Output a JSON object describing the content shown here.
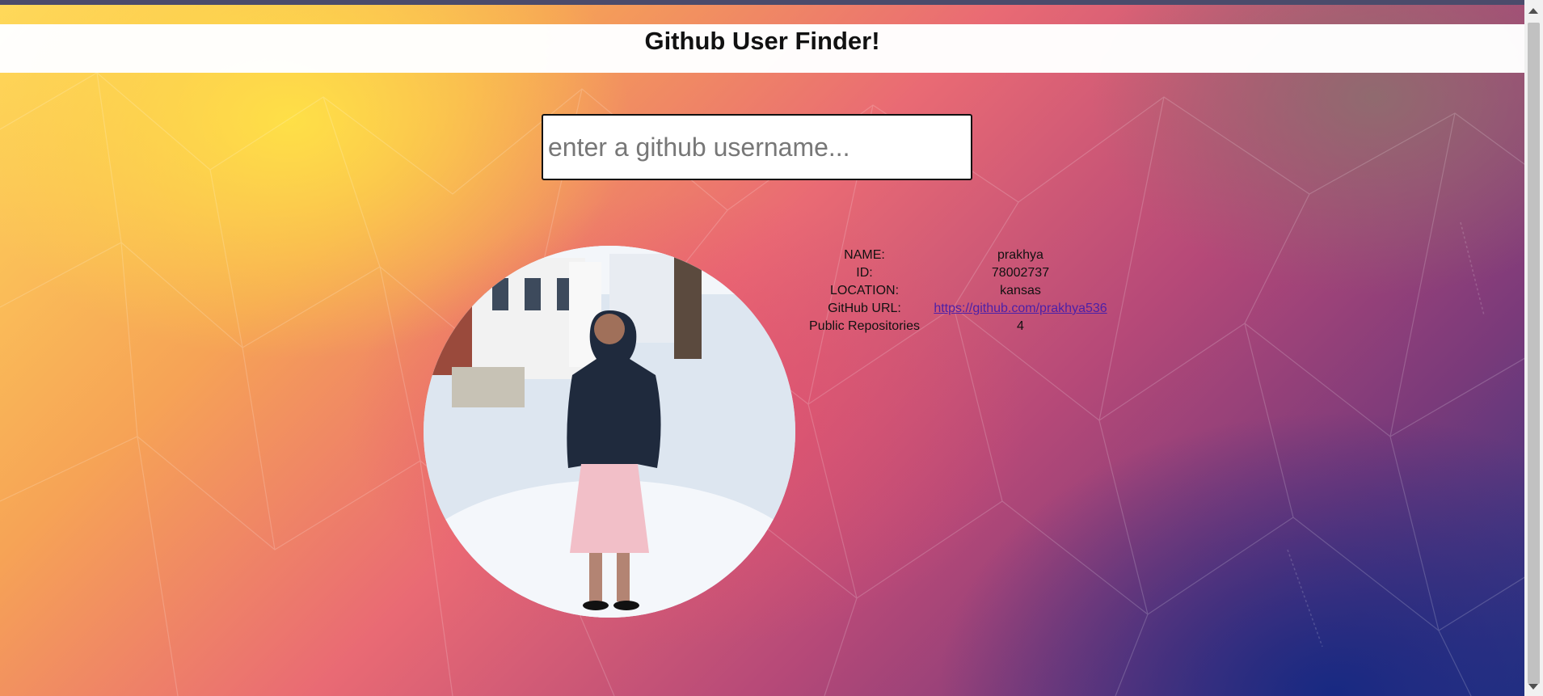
{
  "header": {
    "title": "Github User Finder!"
  },
  "search": {
    "placeholder": "enter a github username...",
    "value": ""
  },
  "profile": {
    "rows": [
      {
        "label": "NAME:",
        "value": "prakhya"
      },
      {
        "label": "ID:",
        "value": "78002737"
      },
      {
        "label": "LOCATION:",
        "value": "kansas"
      },
      {
        "label": "GitHub URL:",
        "value": "https://github.com/prakhya536"
      },
      {
        "label": "Public Repositories",
        "value": "4"
      }
    ]
  },
  "colors": {
    "header_bg": "#ffffff",
    "link": "#4b1fa8",
    "background_top_left": "#ffd95a",
    "background_bottom_right": "#2a3584"
  }
}
